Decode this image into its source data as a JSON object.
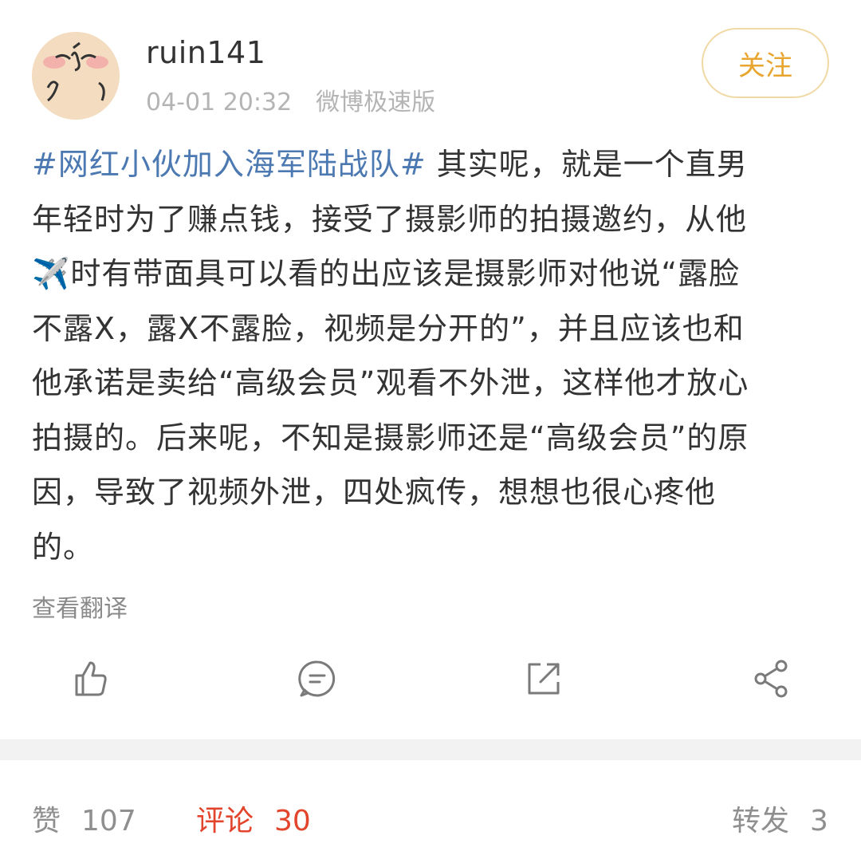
{
  "header": {
    "username": "ruin141",
    "timestamp": "04-01 20:32",
    "source": "微博极速版",
    "follow_label": "关注",
    "avatar_icon": "cartoon-face-avatar"
  },
  "post": {
    "hashtag": "#网红小伙加入海军陆战队#",
    "lines": [
      " 其实呢，就是一个直男",
      "年轻时为了赚点钱，接受了摄影师的拍摄邀约，从他",
      "时有带面具可以看的出应该是摄影师对他说“露脸",
      "不露X，露X不露脸，视频是分开的”，并且应该也和",
      "他承诺是卖给“高级会员”观看不外泄，这样他才放心",
      "拍摄的。后来呢，不知是摄影师还是“高级会员”的原",
      "因，导致了视频外泄，四处疯传，想想也很心疼他",
      "的。"
    ],
    "emoji": "✈️",
    "translate_label": "查看翻译"
  },
  "actions": {
    "like_icon": "thumbs-up-icon",
    "comment_icon": "comment-icon",
    "repost_icon": "repost-icon",
    "share_icon": "share-icon"
  },
  "stats": {
    "likes_label": "赞",
    "likes_count": "107",
    "comments_label": "评论",
    "comments_count": "30",
    "reposts_label": "转发",
    "reposts_count": "3"
  },
  "colors": {
    "hashtag": "#4c79b1",
    "follow": "#e8a530",
    "active_tab": "#e2452b",
    "muted": "#b4b4b4"
  }
}
